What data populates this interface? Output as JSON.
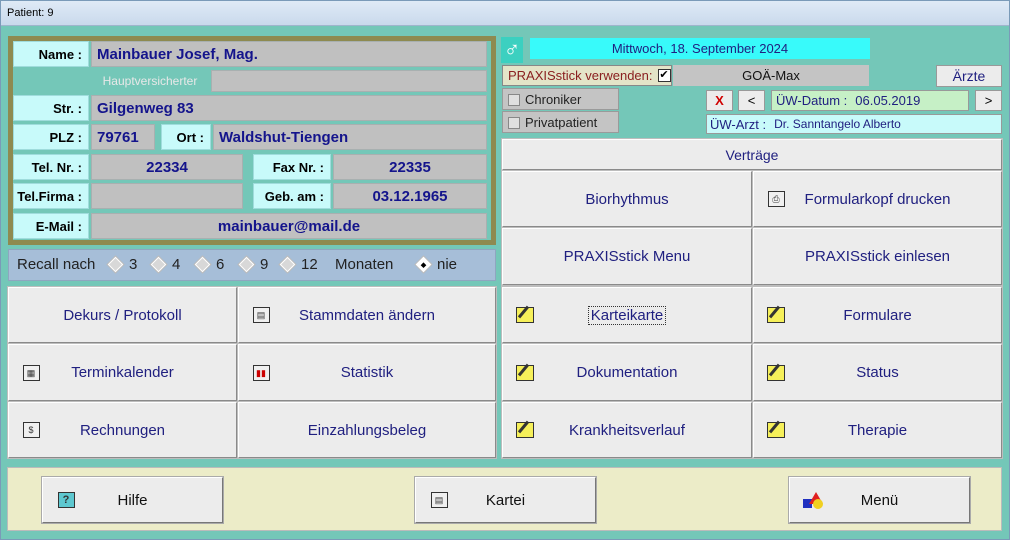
{
  "window": {
    "title": "Patient: 9"
  },
  "patient": {
    "name_label": "Name :",
    "name": "Mainbauer Josef, Mag.",
    "hauptversicherter_label": "Hauptversicherter",
    "street_label": "Str. :",
    "street": "Gilgenweg 83",
    "plz_label": "PLZ :",
    "plz": "79761",
    "ort_label": "Ort :",
    "ort": "Waldshut-Tiengen",
    "tel_label": "Tel. Nr. :",
    "tel": "22334",
    "fax_label": "Fax Nr. :",
    "fax": "22335",
    "telfirma_label": "Tel.Firma :",
    "telfirma": "",
    "geb_label": "Geb. am :",
    "geb": "03.12.1965",
    "email_label": "E-Mail :",
    "email": "mainbauer@mail.de"
  },
  "recall": {
    "label": "Recall nach",
    "options": [
      "3",
      "4",
      "6",
      "9",
      "12"
    ],
    "unit": "Monaten",
    "never": "nie",
    "selected": "nie"
  },
  "header": {
    "gender_symbol": "♂",
    "date": "Mittwoch, 18. September 2024",
    "praxisstick_label": "PRAXISstick verwenden:",
    "praxisstick_checked": "✔",
    "tariff": "GOÄ-Max",
    "aerzte_button": "Ärzte",
    "chroniker": "Chroniker",
    "privatpatient": "Privatpatient",
    "x_button": "X",
    "prev_button": "<",
    "next_button": ">",
    "uew_datum_label": "ÜW-Datum :",
    "uew_datum": "06.05.2019",
    "uew_arzt_label": "ÜW-Arzt :",
    "uew_arzt": "Dr. Sanntangelo Alberto",
    "vertraege": "Verträge"
  },
  "left_buttons": {
    "dekurs": "Dekurs / Protokoll",
    "stammdaten": "Stammdaten ändern",
    "terminkalender": "Terminkalender",
    "statistik": "Statistik",
    "rechnungen": "Rechnungen",
    "einzahlungsbeleg": "Einzahlungsbeleg"
  },
  "right_buttons": {
    "biorhythmus": "Biorhythmus",
    "formularkopf": "Formularkopf drucken",
    "praxisstick_menu": "PRAXISstick Menu",
    "praxisstick_einlesen": "PRAXISstick einlesen",
    "karteikarte": "Karteikarte",
    "formulare": "Formulare",
    "dokumentation": "Dokumentation",
    "status": "Status",
    "krankheitsverlauf": "Krankheitsverlauf",
    "therapie": "Therapie"
  },
  "bottom_buttons": {
    "hilfe": "Hilfe",
    "kartei": "Kartei",
    "menu": "Menü"
  },
  "colors": {
    "background": "#74c7b8",
    "label_bg": "#c8fafa",
    "value_text": "#14148c",
    "date_bg": "#38fafa"
  }
}
